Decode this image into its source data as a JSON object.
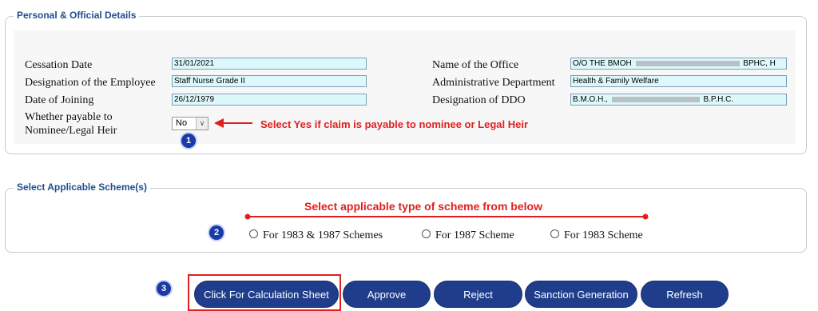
{
  "personal_section": {
    "legend": "Personal & Official Details",
    "fields_left": [
      {
        "label": "Cessation Date",
        "value": "31/01/2021"
      },
      {
        "label": "Designation of the Employee",
        "value": "Staff Nurse Grade II"
      },
      {
        "label": "Date of Joining",
        "value": "26/12/1979"
      }
    ],
    "fields_right": [
      {
        "label": "Name of the Office",
        "value_prefix": "O/O THE BMOH",
        "value_suffix": "BPHC, H"
      },
      {
        "label": "Administrative Department",
        "value": "Health & Family Welfare"
      },
      {
        "label": "Designation of DDO",
        "value_prefix": "B.M.O.H.,",
        "value_suffix": "B.P.H.C."
      }
    ],
    "payable_label_line1": "Whether payable to",
    "payable_label_line2": "Nominee/Legal Heir",
    "payable_selected": "No",
    "payable_annotation": "Select Yes if claim is payable to nominee or Legal Heir"
  },
  "scheme_section": {
    "legend": "Select Applicable Scheme(s)",
    "annotation": "Select applicable type of scheme from below",
    "options": [
      "For 1983 & 1987 Schemes",
      "For 1987 Scheme",
      "For 1983 Scheme"
    ]
  },
  "badges": [
    "1",
    "2",
    "3"
  ],
  "buttons": {
    "calc": "Click For Calculation Sheet",
    "approve": "Approve",
    "reject": "Reject",
    "sanction": "Sanction Generation",
    "refresh": "Refresh"
  },
  "colors": {
    "accent_blue": "#1f3d8a",
    "annotation_red": "#e02020",
    "input_bg": "#dcf8fb",
    "badge_blue": "#1a3aa8"
  }
}
